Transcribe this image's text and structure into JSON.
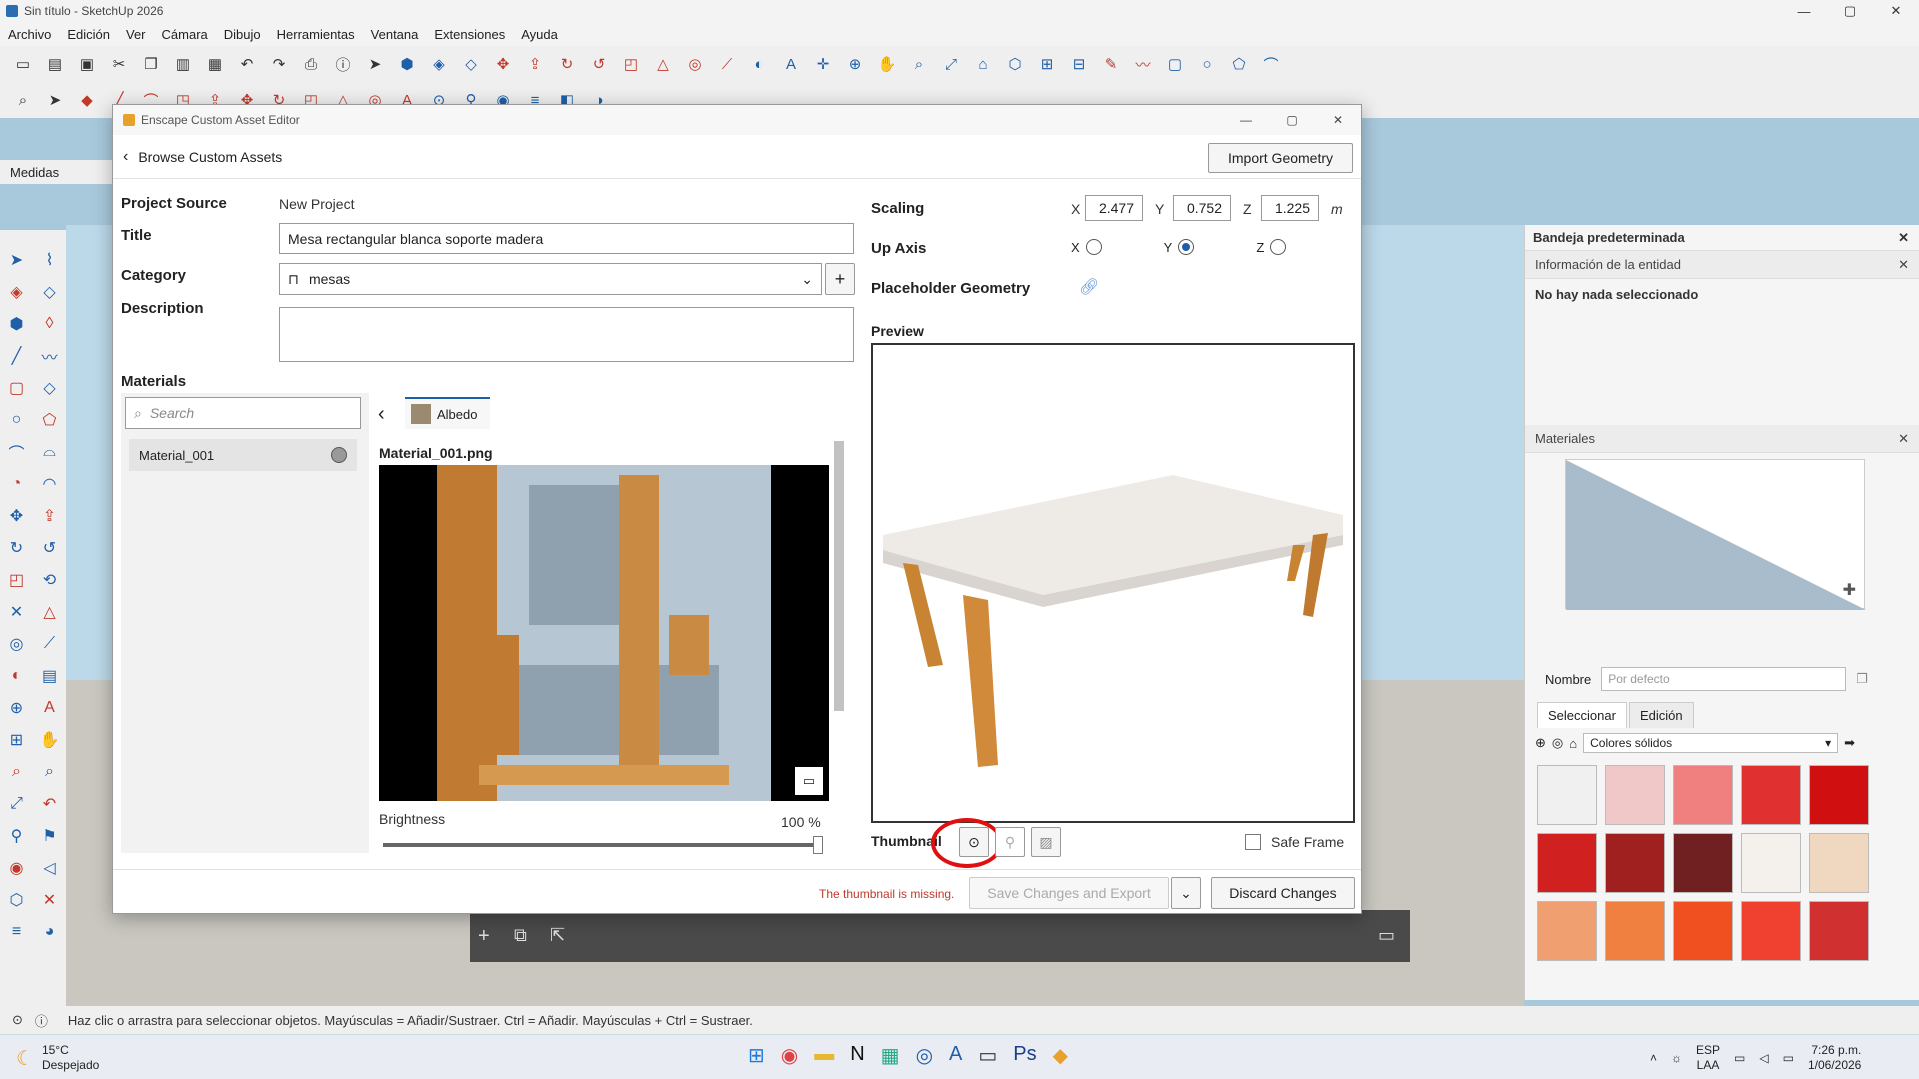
{
  "window": {
    "title": "Sin título - SketchUp 2026"
  },
  "menu": [
    "Archivo",
    "Edición",
    "Ver",
    "Cámara",
    "Dibujo",
    "Herramientas",
    "Ventana",
    "Extensiones",
    "Ayuda"
  ],
  "toolbar": {
    "medidas": "Medidas"
  },
  "dialog": {
    "title": "Enscape Custom Asset Editor",
    "back_label": "Browse Custom Assets",
    "import_label": "Import Geometry",
    "project_source_label": "Project Source",
    "project_source_value": "New Project",
    "title_label": "Title",
    "title_value": "Mesa rectangular blanca soporte madera",
    "category_label": "Category",
    "category_value": "mesas",
    "description_label": "Description",
    "description_value": "",
    "materials_label": "Materials",
    "search_placeholder": "Search",
    "material_item": "Material_001",
    "albedo_tab": "Albedo",
    "texture_name": "Material_001.png",
    "brightness_label": "Brightness",
    "brightness_value": "100 %",
    "brightness_fraction": 1.0,
    "scaling_label": "Scaling",
    "scale_x_label": "X",
    "scale_x": "2.477",
    "scale_y_label": "Y",
    "scale_y": "0.752",
    "scale_z_label": "Z",
    "scale_z": "1.225",
    "scale_unit": "m",
    "up_axis_label": "Up Axis",
    "up_axis_selected": "Y",
    "placeholder_label": "Placeholder Geometry",
    "preview_label": "Preview",
    "thumbnail_label": "Thumbnail",
    "safe_frame_label": "Safe Frame",
    "thumbnail_missing": "The thumbnail is missing.",
    "save_label": "Save Changes and Export",
    "discard_label": "Discard Changes"
  },
  "right_panel": {
    "tray_title": "Bandeja predeterminada",
    "entity_section": "Información de la entidad",
    "entity_none": "No hay nada seleccionado",
    "materials_section": "Materiales",
    "name_label": "Nombre",
    "name_placeholder": "Por defecto",
    "tab_select": "Seleccionar",
    "tab_edit": "Edición",
    "library": "Colores sólidos",
    "swatch_colors": [
      "#f0f0f0",
      "#f0c8c8",
      "#f08080",
      "#e03030",
      "#d01010",
      "#d02020",
      "#a02020",
      "#702020",
      "#f4f0ec",
      "#f0d8c0",
      "#f0a070",
      "#f08040",
      "#f05020",
      "#f04030",
      "#d03030"
    ]
  },
  "status": {
    "hint": "Haz clic o arrastra para seleccionar objetos. Mayúsculas = Añadir/Sustraer. Ctrl = Añadir. Mayúsculas + Ctrl = Sustraer."
  },
  "taskbar": {
    "temp": "15°C",
    "weather": "Despejado",
    "lang1": "ESP",
    "lang2": "LAA",
    "time": "7:26 p.m.",
    "date": "1/06/2026"
  },
  "colors": {
    "accent": "#1f5fa8",
    "missing": "#c0392b",
    "highlight_ring": "#e01010"
  }
}
